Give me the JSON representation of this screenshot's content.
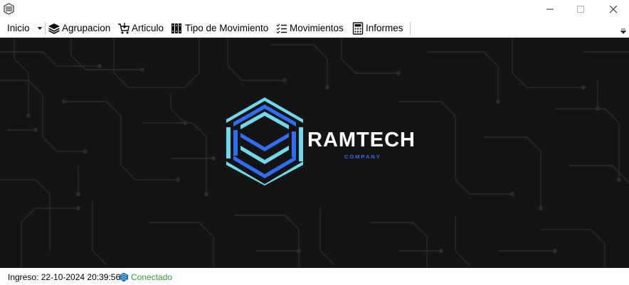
{
  "menu": {
    "inicio": "Inicio",
    "agrupacion": "Agrupacion",
    "articulo": "Articulo",
    "tipo_movimiento": "Tipo de Movimiento",
    "movimientos": "Movimientos",
    "informes": "Informes"
  },
  "brand": {
    "name": "RAMTECH",
    "subtitle": "COMPANY"
  },
  "status": {
    "ingreso": "Ingreso: 22-10-2024 20:39:56",
    "connection": "Conectado"
  },
  "colors": {
    "background": "#141414",
    "accent_blue": "#2f6df2",
    "accent_cyan": "#6fd8ea",
    "connected_green": "#2ea02e"
  }
}
